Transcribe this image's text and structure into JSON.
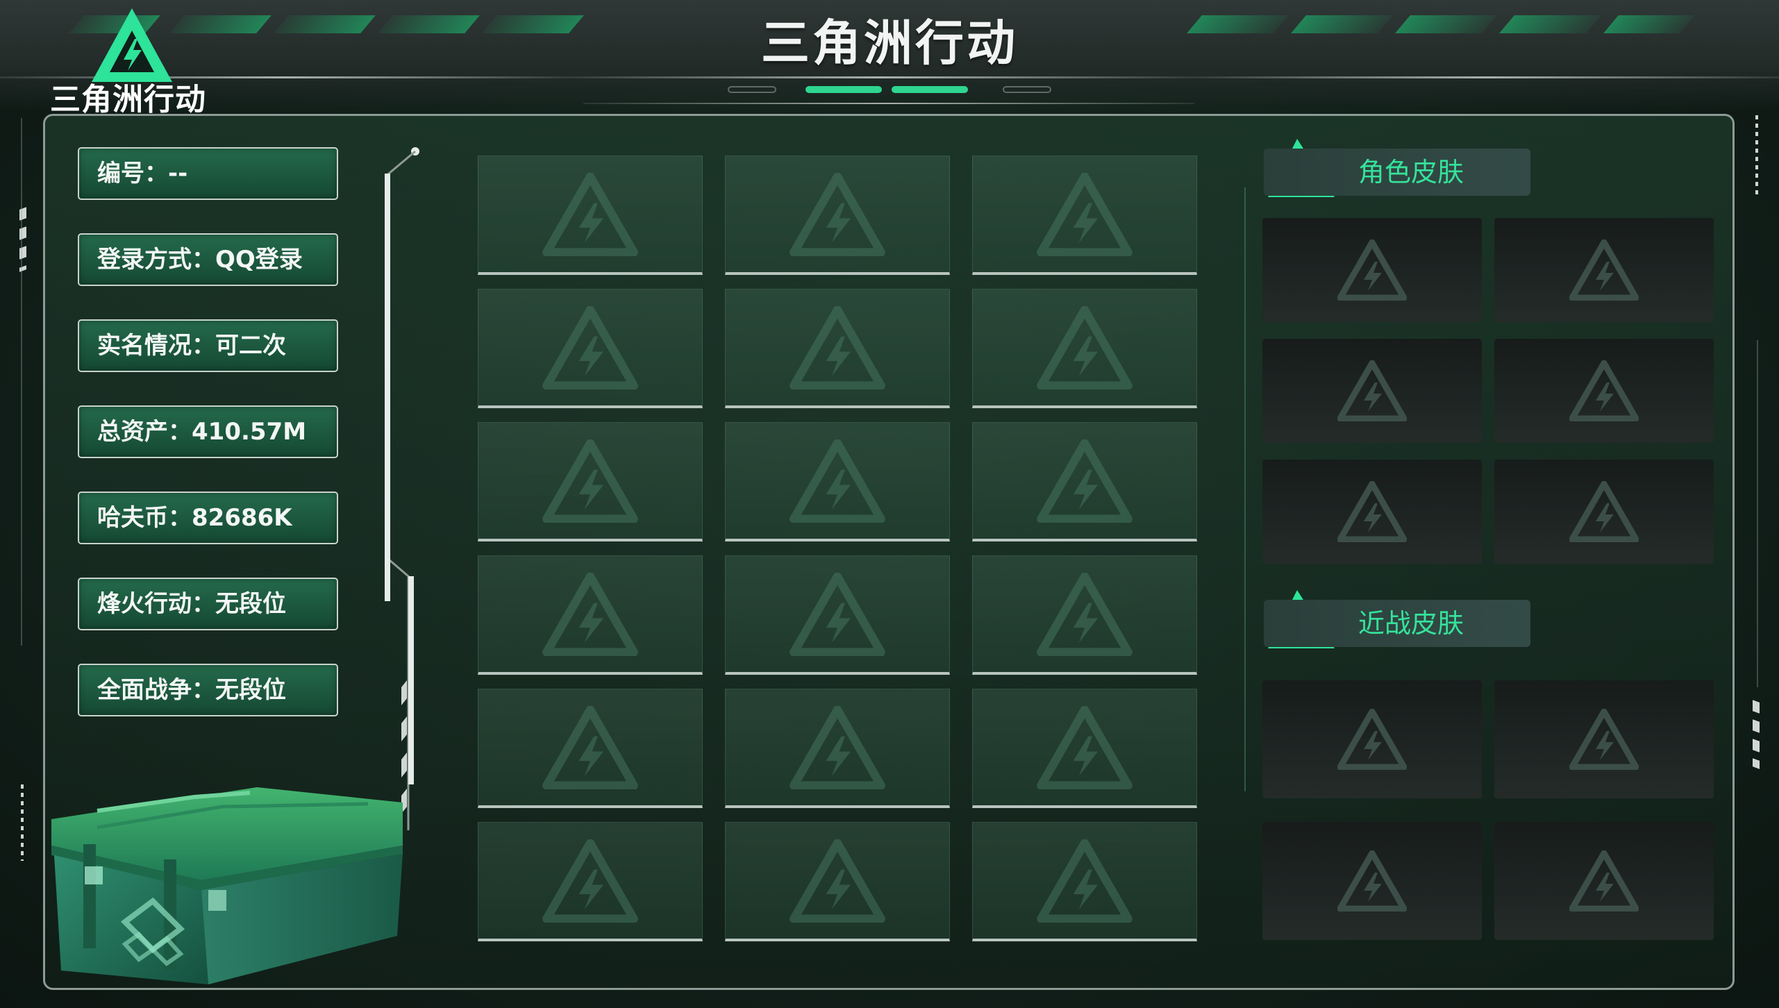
{
  "header": {
    "title": "三角洲行动",
    "logo_text": "三角洲行动"
  },
  "account_info": [
    {
      "label": "编号：--"
    },
    {
      "label": "登录方式：QQ登录"
    },
    {
      "label": "实名情况：可二次"
    },
    {
      "label": "总资产：410.57M"
    },
    {
      "label": "哈夫币：82686K"
    },
    {
      "label": "烽火行动：无段位"
    },
    {
      "label": "全面战争：无段位"
    }
  ],
  "item_grid": {
    "rows": 6,
    "columns": 3,
    "slots_filled": 0
  },
  "sections": {
    "character_skins": {
      "title": "角色皮肤",
      "slot_count": 6
    },
    "melee_skins": {
      "title": "近战皮肤",
      "slot_count": 4
    }
  },
  "colors": {
    "accent": "#2fe39a",
    "button_green": "#1f5f43",
    "frame_border": "#8d9a95",
    "background": "#14241d"
  },
  "icons": {
    "logo": "delta-triangle-logo-icon",
    "section": "delta-triangle-icon",
    "placeholder": "delta-watermark-icon",
    "chest": "supply-crate-icon"
  }
}
